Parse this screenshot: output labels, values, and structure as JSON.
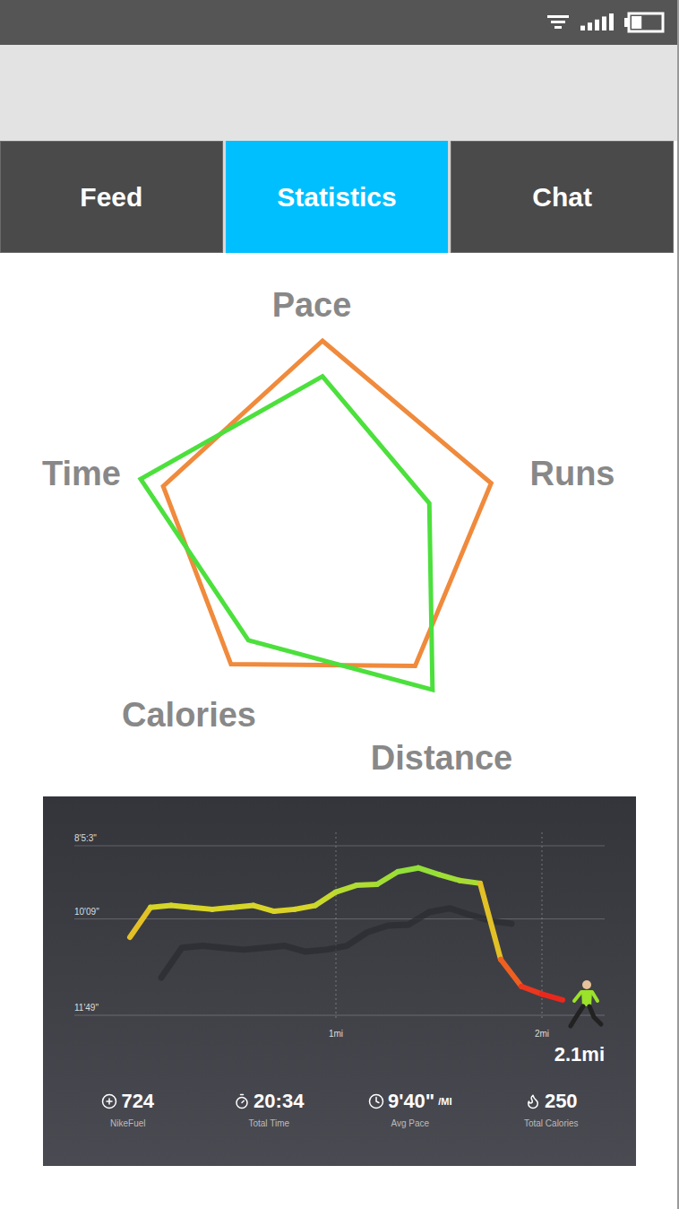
{
  "status_bar": {
    "signal": {
      "level": 1
    },
    "battery": {
      "level": 0.35
    }
  },
  "tabs": [
    {
      "label": "Feed",
      "selected": false
    },
    {
      "label": "Statistics",
      "selected": true
    },
    {
      "label": "Chat",
      "selected": false
    }
  ],
  "radar": {
    "axes": [
      "Pace",
      "Runs",
      "Distance",
      "Calories",
      "Time"
    ],
    "max": 100,
    "series": [
      {
        "color": "#f08a3c",
        "values": [
          100,
          90,
          80,
          79,
          85
        ]
      },
      {
        "color": "#4ce03c",
        "values": [
          82,
          57,
          95,
          64,
          97
        ]
      }
    ]
  },
  "run_card": {
    "y_ticks": [
      {
        "label": "8'5:3\"",
        "value": 533
      },
      {
        "label": "10'09\"",
        "value": 609
      },
      {
        "label": "11'49\"",
        "value": 709
      }
    ],
    "x_ticks": [
      {
        "label": "1mi",
        "value": 1
      },
      {
        "label": "2mi",
        "value": 2
      }
    ],
    "distance_label": "2.1mi",
    "pace": {
      "end_mi": 2.1,
      "values": [
        628,
        597,
        595,
        597,
        599,
        597,
        595,
        601,
        599,
        595,
        581,
        574,
        573,
        560,
        556,
        563,
        569,
        572,
        651,
        679,
        687,
        693
      ]
    },
    "stats": [
      {
        "value": "724",
        "unit": "",
        "label": "NikeFuel"
      },
      {
        "value": "20:34",
        "unit": "",
        "label": "Total Time"
      },
      {
        "value": "9'40\"",
        "unit": "/MI",
        "label": "Avg Pace"
      },
      {
        "value": "250",
        "unit": "",
        "label": "Total Calories"
      }
    ]
  }
}
